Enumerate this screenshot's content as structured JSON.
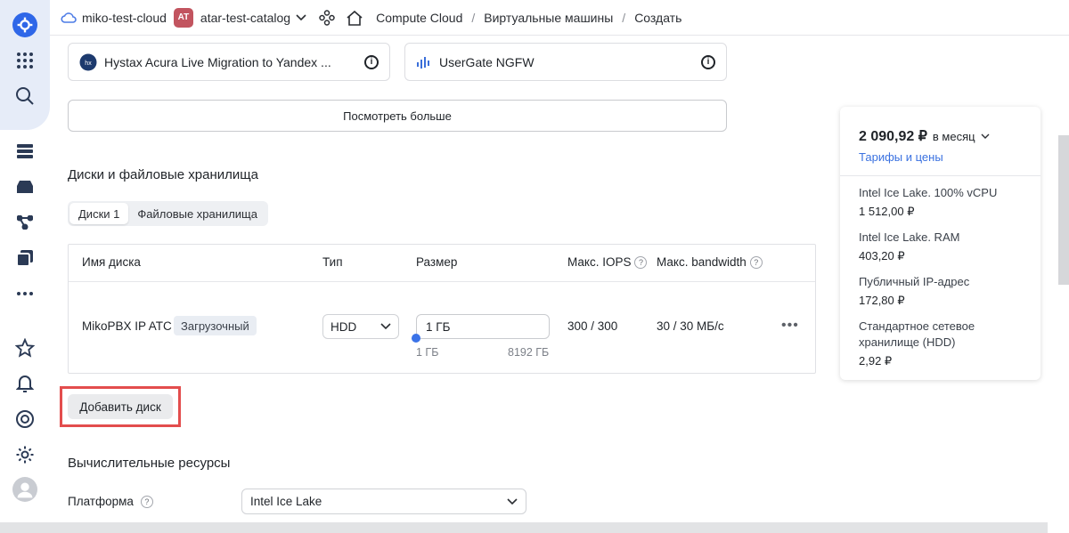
{
  "header": {
    "cloud_name": "miko-test-cloud",
    "catalog_badge": "AT",
    "catalog_name": "atar-test-catalog",
    "breadcrumbs": [
      "Compute Cloud",
      "Виртуальные машины",
      "Создать"
    ]
  },
  "marketplace": {
    "card1_title": "Hystax Acura Live Migration to Yandex ...",
    "card2_title": "UserGate NGFW",
    "info_glyph": "i",
    "more_button": "Посмотреть больше"
  },
  "disks": {
    "section_title": "Диски и файловые хранилища",
    "tabs": [
      "Диски 1",
      "Файловые хранилища"
    ],
    "columns": {
      "name": "Имя диска",
      "type": "Тип",
      "size": "Размер",
      "iops": "Макс. IOPS",
      "bandwidth": "Макс. bandwidth"
    },
    "row": {
      "name": "MikoPBX IP ATC",
      "badge": "Загрузочный",
      "type": "HDD",
      "size": "1 ГБ",
      "size_min": "1 ГБ",
      "size_max": "8192 ГБ",
      "iops": "300 / 300",
      "bandwidth": "30 / 30 МБ/с"
    },
    "add_button": "Добавить диск"
  },
  "compute": {
    "section_title": "Вычислительные ресурсы",
    "platform_label": "Платформа",
    "platform_value": "Intel Ice Lake"
  },
  "price": {
    "total": "2 090,92 ₽",
    "period": "в месяц",
    "link": "Тарифы и цены",
    "items": [
      {
        "name": "Intel Ice Lake. 100% vCPU",
        "value": "1 512,00 ₽"
      },
      {
        "name": "Intel Ice Lake. RAM",
        "value": "403,20 ₽"
      },
      {
        "name": "Публичный IP-адрес",
        "value": "172,80 ₽"
      },
      {
        "name": "Стандартное сетевое хранилище (HDD)",
        "value": "2,92 ₽"
      }
    ]
  },
  "colors": {
    "accent": "#3a71e0",
    "highlight": "#e34d4d",
    "catalog_badge": "#c2545f"
  }
}
